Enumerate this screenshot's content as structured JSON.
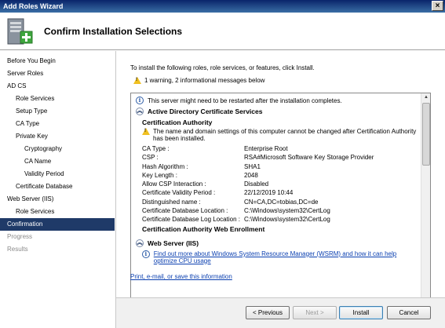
{
  "window": {
    "title": "Add Roles Wizard",
    "close_glyph": "×"
  },
  "header": {
    "title": "Confirm Installation Selections",
    "icon": "server-add-icon"
  },
  "sidebar": {
    "items": [
      {
        "label": "Before You Begin",
        "level": 0,
        "state": "normal"
      },
      {
        "label": "Server Roles",
        "level": 0,
        "state": "normal"
      },
      {
        "label": "AD CS",
        "level": 0,
        "state": "normal"
      },
      {
        "label": "Role Services",
        "level": 1,
        "state": "normal"
      },
      {
        "label": "Setup Type",
        "level": 1,
        "state": "normal"
      },
      {
        "label": "CA Type",
        "level": 1,
        "state": "normal"
      },
      {
        "label": "Private Key",
        "level": 1,
        "state": "normal"
      },
      {
        "label": "Cryptography",
        "level": 2,
        "state": "normal"
      },
      {
        "label": "CA Name",
        "level": 2,
        "state": "normal"
      },
      {
        "label": "Validity Period",
        "level": 2,
        "state": "normal"
      },
      {
        "label": "Certificate Database",
        "level": 1,
        "state": "normal"
      },
      {
        "label": "Web Server (IIS)",
        "level": 0,
        "state": "normal"
      },
      {
        "label": "Role Services",
        "level": 1,
        "state": "normal"
      },
      {
        "label": "Confirmation",
        "level": 0,
        "state": "active"
      },
      {
        "label": "Progress",
        "level": 0,
        "state": "disabled"
      },
      {
        "label": "Results",
        "level": 0,
        "state": "disabled"
      }
    ]
  },
  "main": {
    "intro": "To install the following roles, role services, or features, click Install.",
    "summary": "1 warning, 2 informational messages below",
    "restart_info": "This server might need to be restarted after the installation completes.",
    "adcs": {
      "title": "Active Directory Certificate Services",
      "ca_title": "Certification Authority",
      "warning": "The name and domain settings of this computer cannot be changed after Certification Authority has been installed.",
      "settings": [
        {
          "key": "CA Type :",
          "value": "Enterprise Root"
        },
        {
          "key": "CSP :",
          "value": "RSA#Microsoft Software Key Storage Provider"
        },
        {
          "key": "Hash Algorithm :",
          "value": "SHA1"
        },
        {
          "key": "Key Length :",
          "value": "2048"
        },
        {
          "key": "Allow CSP Interaction :",
          "value": "Disabled"
        },
        {
          "key": "Certificate Validity Period :",
          "value": "22/12/2019 10:44"
        },
        {
          "key": "Distinguished name :",
          "value": "CN=CA,DC=tobias,DC=de"
        },
        {
          "key": "Certificate Database Location :",
          "value": "C:\\Windows\\system32\\CertLog"
        },
        {
          "key": "Certificate Database Log Location :",
          "value": "C:\\Windows\\system32\\CertLog"
        }
      ],
      "web_enrollment_title": "Certification Authority Web Enrollment"
    },
    "iis": {
      "title": "Web Server (IIS)",
      "info_link": "Find out more about Windows System Resource Manager (WSRM) and how it can help optimize CPU usage"
    },
    "print_link": "Print, e-mail, or save this information"
  },
  "footer": {
    "previous_label": "< Previous",
    "next_label": "Next >",
    "install_label": "Install",
    "cancel_label": "Cancel"
  },
  "colors": {
    "titlebar": "#0a246a",
    "active_nav": "#1f3a68",
    "link": "#0a3fb0",
    "warning": "#f0c020",
    "info": "#2f5ea8"
  }
}
